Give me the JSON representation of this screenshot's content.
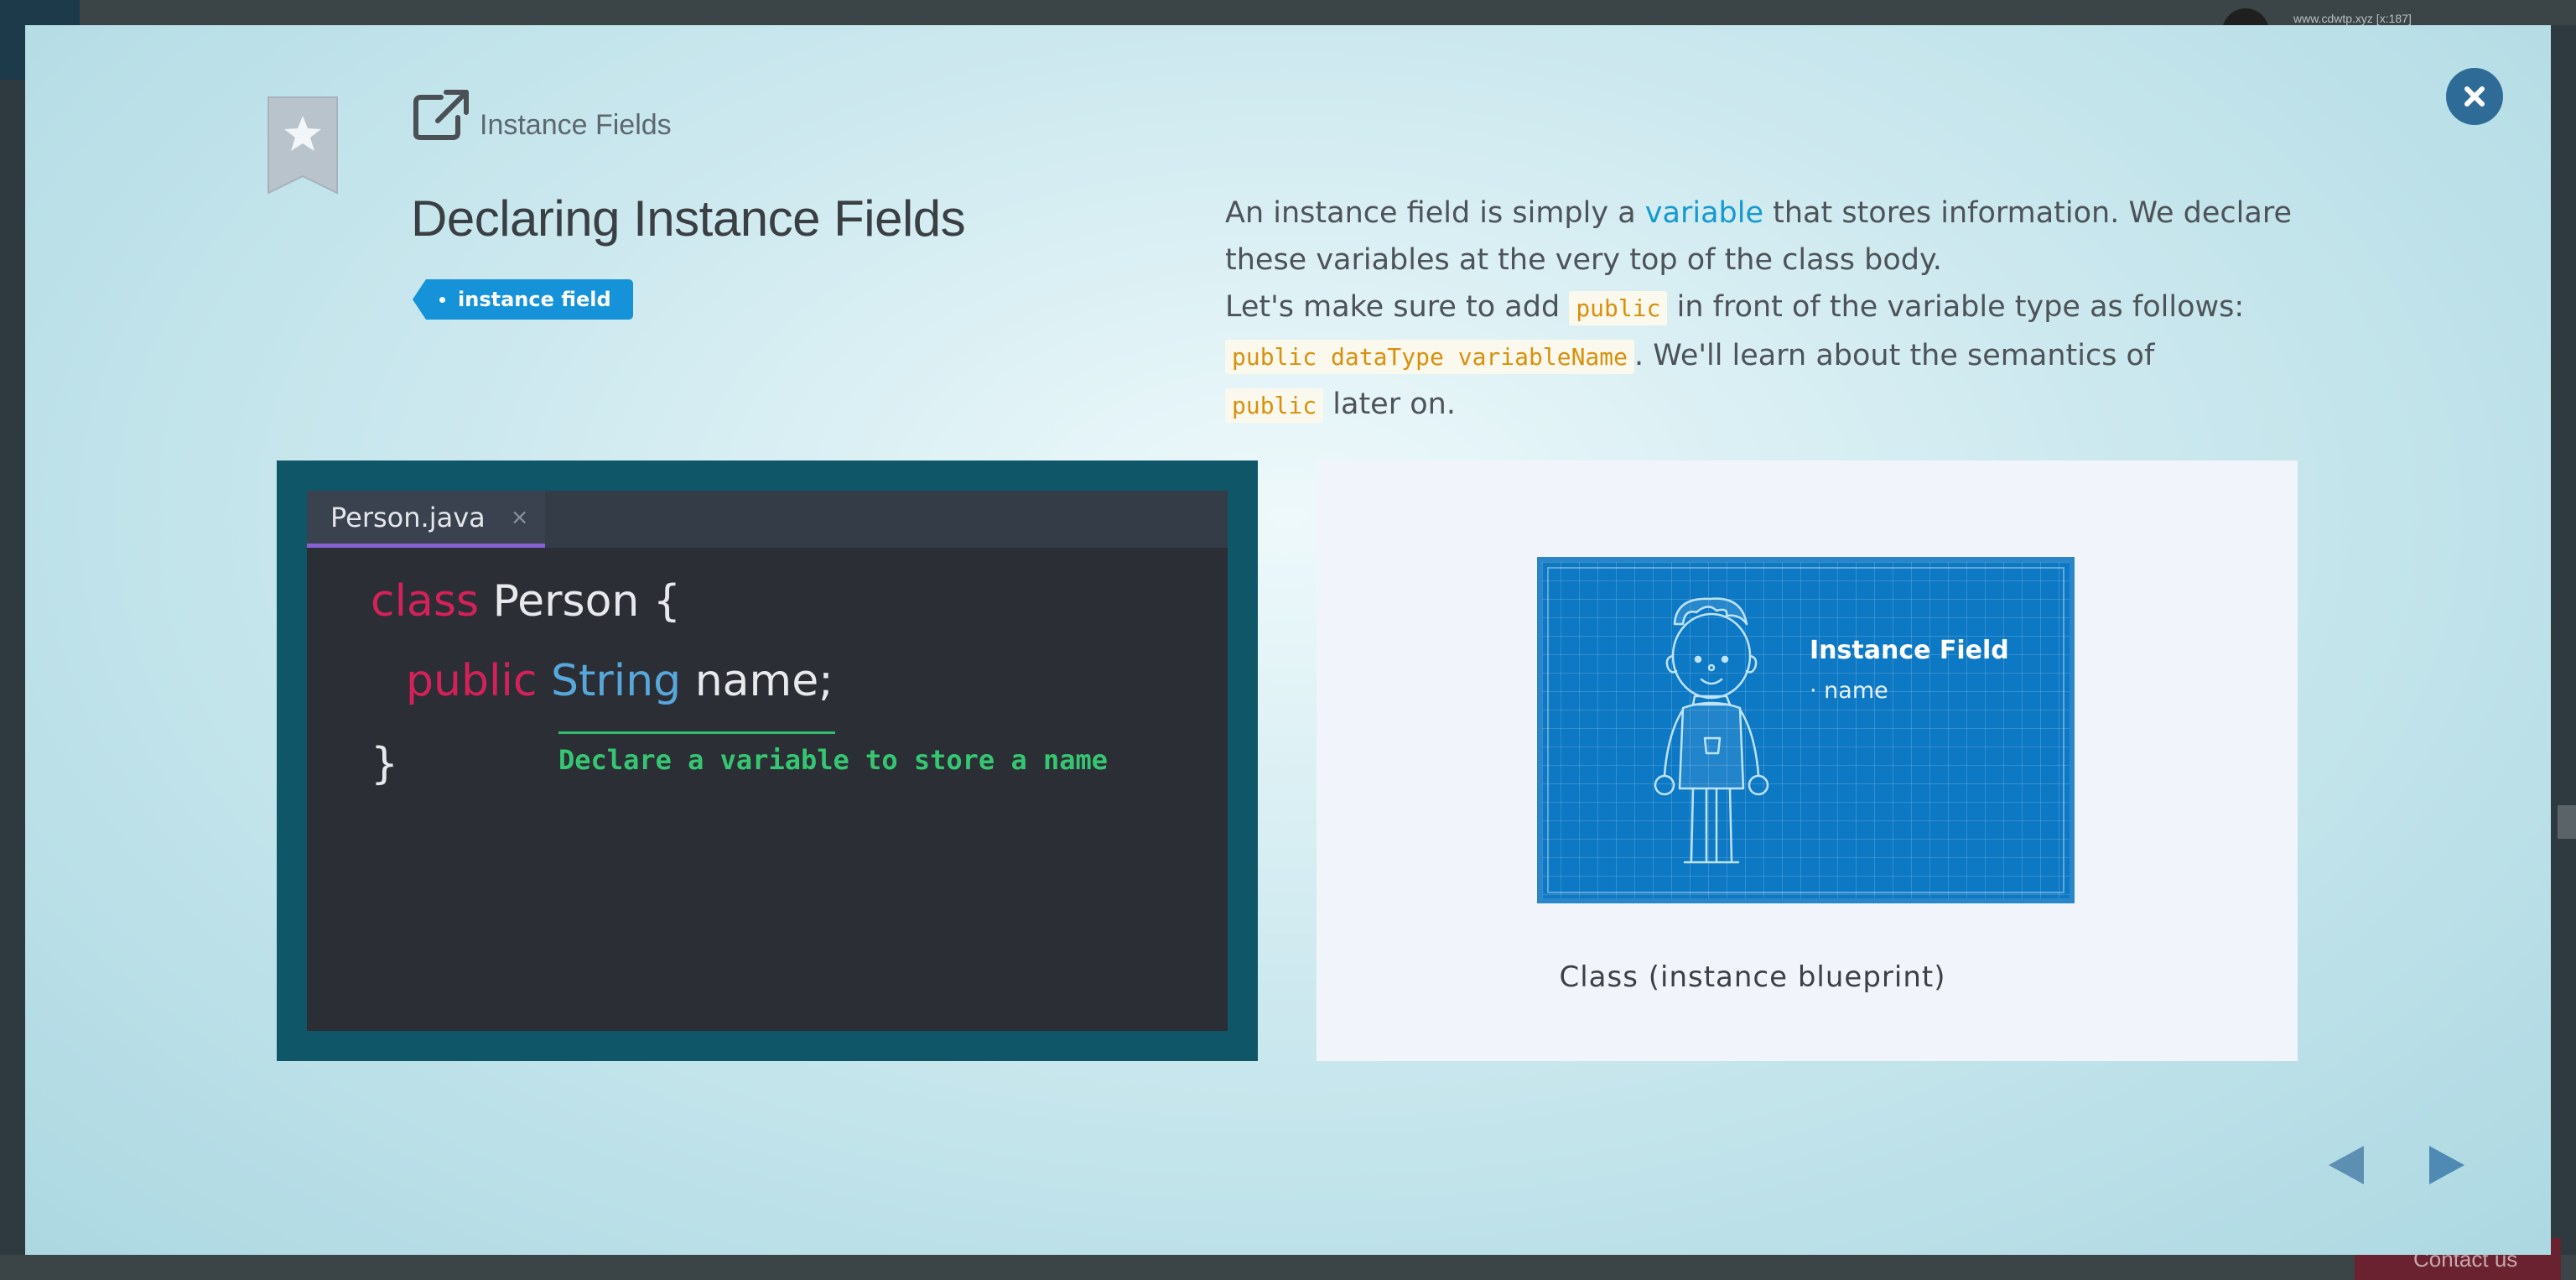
{
  "background": {
    "url_text": "www.cdwtp.xyz [x:187]",
    "contact_button": "Contact us"
  },
  "modal": {
    "breadcrumb": "Instance Fields",
    "title": "Declaring Instance Fields",
    "tag": "instance field",
    "description": {
      "line1_pre": "An instance field is simply a ",
      "line1_link": "variable",
      "line1_post": " that stores information. We declare these variables at the very top of the class body.",
      "line2_pre": "Let's make sure to add ",
      "line2_code": "public",
      "line2_post": " in front of the variable type as follows:",
      "line3_code": "public dataType variableName",
      "line3_post": ". We'll learn about the semantics of",
      "line4_code": "public",
      "line4_post": " later on."
    },
    "editor": {
      "tab_name": "Person.java",
      "tab_close": "×",
      "line1_kw": "class",
      "line1_rest": " Person {",
      "line2_kw": "public",
      "line2_type": "String",
      "line2_rest": " name;",
      "line3": "}",
      "annotation": "Declare a variable to store a name"
    },
    "diagram": {
      "blueprint_title": "Instance Field",
      "blueprint_field": "· name",
      "caption": "Class (instance blueprint)"
    }
  },
  "colors": {
    "accent": "#1592d8",
    "link": "#149ad0",
    "code_keyword": "#d5215a",
    "code_type": "#58a7da",
    "annotation": "#36c672",
    "blueprint": "#0d78c4"
  },
  "icons": {
    "close": "close-icon",
    "bookmark": "bookmark-star-icon",
    "external_link": "external-link-icon",
    "prev": "arrow-left-icon",
    "next": "arrow-right-icon"
  }
}
